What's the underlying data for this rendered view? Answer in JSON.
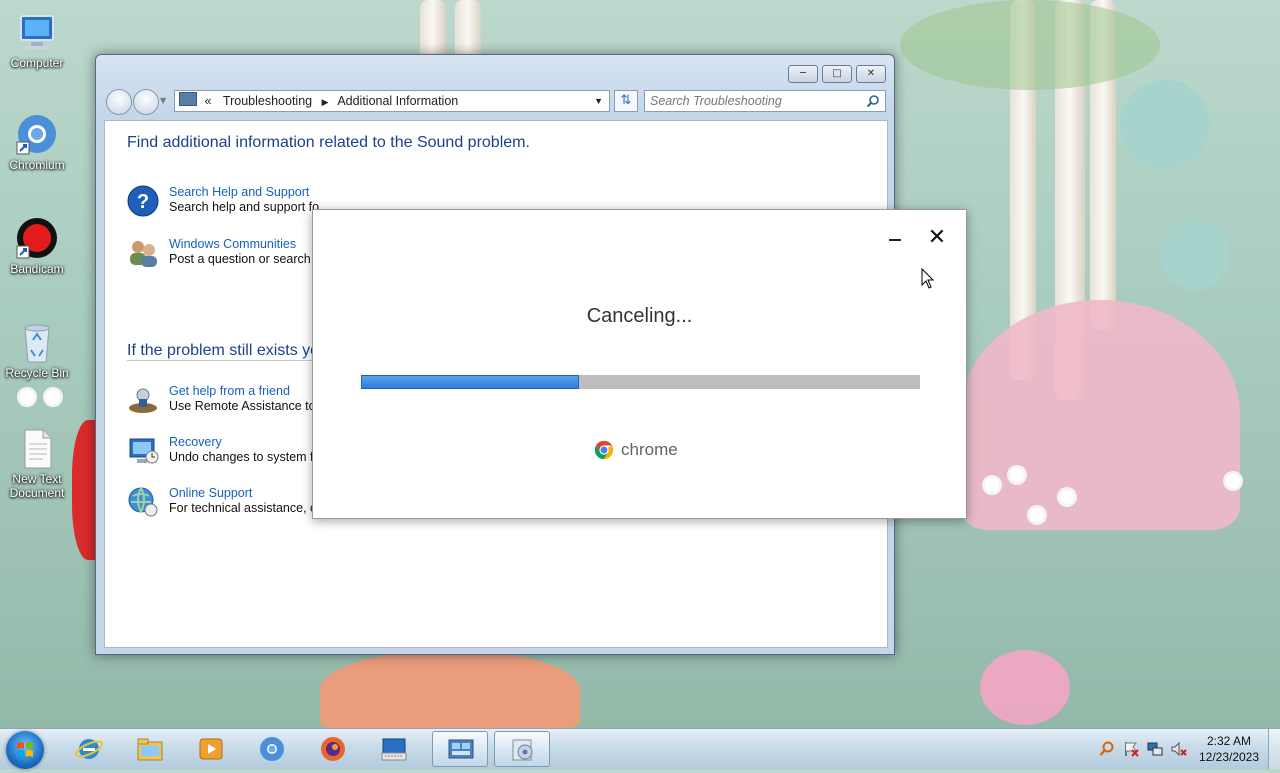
{
  "desktop": {
    "icons": [
      {
        "label": "Computer",
        "icon": "computer-icon"
      },
      {
        "label": "Chromium",
        "icon": "chromium-icon"
      },
      {
        "label": "Bandicam",
        "icon": "bandicam-icon"
      },
      {
        "label": "Recycle Bin",
        "icon": "recycle-bin-icon"
      },
      {
        "label": "New Text Document",
        "icon": "text-document-icon"
      }
    ]
  },
  "explorer": {
    "breadcrumb": {
      "chevron": "«",
      "items": [
        "Troubleshooting",
        "Additional Information"
      ]
    },
    "search_placeholder": "Search Troubleshooting",
    "heading": "Find additional information related to the Sound problem.",
    "items_top": [
      {
        "link": "Search Help and Support",
        "desc": "Search help and support fo",
        "icon": "help-icon"
      },
      {
        "link": "Windows Communities",
        "desc": "Post a question or search fo",
        "icon": "communities-icon"
      }
    ],
    "heading2": "If the problem still exists yo",
    "items_bottom": [
      {
        "link": "Get help from a friend",
        "desc": "Use Remote Assistance to c",
        "icon": "remote-assistance-icon"
      },
      {
        "link": "Recovery",
        "desc": "Undo changes to system fil",
        "icon": "recovery-icon"
      },
      {
        "link": "Online Support",
        "desc": "For technical assistance, co",
        "icon": "online-support-icon"
      }
    ]
  },
  "dialog": {
    "title": "Canceling...",
    "progress": 0.39,
    "brand": "chrome"
  },
  "taskbar": {
    "items": [
      "ie-icon",
      "explorer-icon",
      "media-player-icon",
      "chrome-icon",
      "firefox-icon",
      "keyboard-icon",
      "control-panel-icon",
      "troubleshoot-icon"
    ],
    "active": [
      6,
      7
    ],
    "tray_icons": [
      "search-icon",
      "action-center-icon",
      "network-icon",
      "volume-muted-icon"
    ],
    "time": "2:32 AM",
    "date": "12/23/2023"
  },
  "colors": {
    "link": "#1560bd",
    "heading": "#1e3f8a",
    "progress": "#2f7fdd"
  }
}
